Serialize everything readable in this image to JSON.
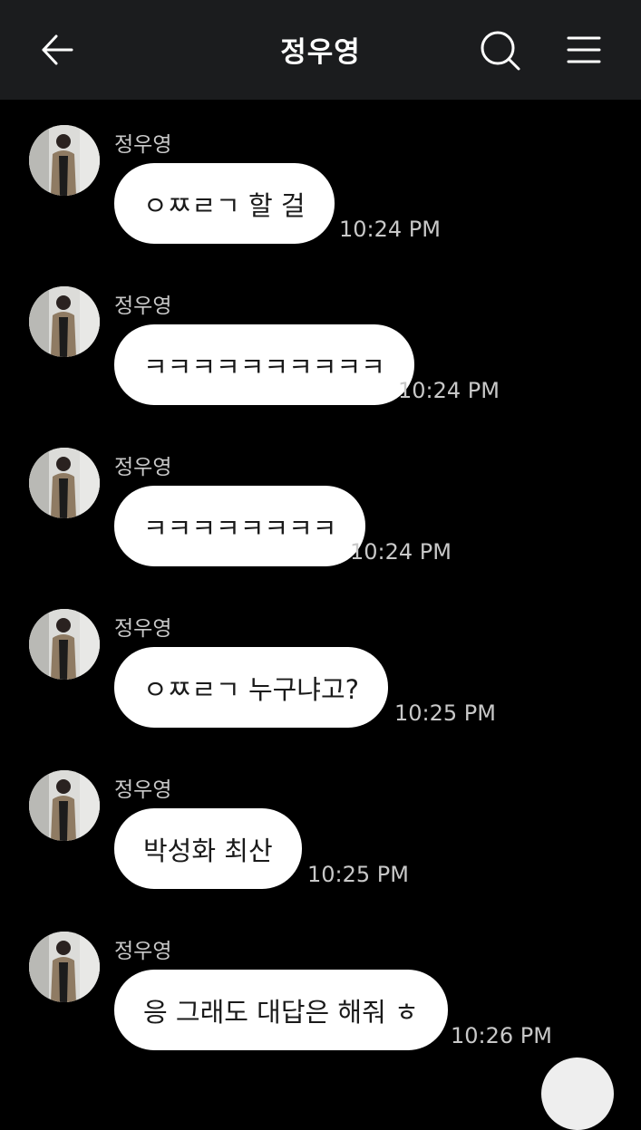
{
  "header": {
    "title": "정우영",
    "back_icon": "arrow-left-icon",
    "search_icon": "search-icon",
    "menu_icon": "hamburger-menu-icon"
  },
  "messages": [
    {
      "sender": "정우영",
      "text": "ㅇㅉㄹㄱ 할 걸",
      "time": "10:24 PM"
    },
    {
      "sender": "정우영",
      "text": "ㅋㅋㅋㅋㅋㅋㅋㅋㅋㅋ",
      "time": "10:24 PM"
    },
    {
      "sender": "정우영",
      "text": "ㅋㅋㅋㅋㅋㅋㅋㅋ",
      "time": "10:24 PM"
    },
    {
      "sender": "정우영",
      "text": "ㅇㅉㄹㄱ 누구냐고?",
      "time": "10:25 PM"
    },
    {
      "sender": "정우영",
      "text": "박성화 최산",
      "time": "10:25 PM"
    },
    {
      "sender": "정우영",
      "text": "응 그래도 대답은 해줘 ㅎ",
      "time": "10:26 PM"
    }
  ],
  "colors": {
    "header_bg": "#1b1c1e",
    "background": "#000000",
    "bubble": "#ffffff",
    "bubble_text": "#1a1a1a",
    "meta_text": "#c8c8c8"
  }
}
